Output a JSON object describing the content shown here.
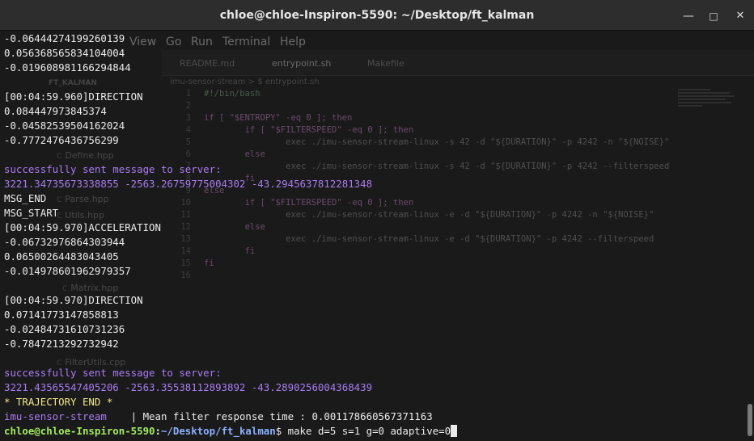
{
  "window": {
    "title": "chloe@chloe-Inspiron-5590: ~/Desktop/ft_kalman"
  },
  "ghost": {
    "menu": [
      "View",
      "Go",
      "Run",
      "Terminal",
      "Help"
    ],
    "tabs": [
      "README.md",
      "entrypoint.sh",
      "Makefile"
    ],
    "breadcrumb": "imu-sensor-stream  >  $  entrypoint.sh",
    "explorer_section": "FT_KALMAN",
    "files": [
      "Define.hpp",
      "Parse.hpp",
      "Utils.hpp",
      "Matrix.hpp",
      "FilterUtils.cpp"
    ],
    "code_lines": [
      {
        "n": "1",
        "t": "#!/bin/bash",
        "k": "cm"
      },
      {
        "n": "2",
        "t": "",
        "k": "plain"
      },
      {
        "n": "3",
        "t": "if [ \"$ENTROPY\" -eq 0 ]; then",
        "k": "kw"
      },
      {
        "n": "4",
        "t": "        if [ \"$FILTERSPEED\" -eq 0 ]; then",
        "k": "kw"
      },
      {
        "n": "5",
        "t": "                exec ./imu-sensor-stream-linux -s 42 -d \"${DURATION}\" -p 4242 -n \"${NOISE}\"",
        "k": "plain"
      },
      {
        "n": "6",
        "t": "        else",
        "k": "kw"
      },
      {
        "n": "7",
        "t": "                exec ./imu-sensor-stream-linux -s 42 -d \"${DURATION}\" -p 4242 --filterspeed",
        "k": "plain"
      },
      {
        "n": "8",
        "t": "        fi",
        "k": "kw"
      },
      {
        "n": "9",
        "t": "else",
        "k": "kw"
      },
      {
        "n": "10",
        "t": "        if [ \"$FILTERSPEED\" -eq 0 ]; then",
        "k": "kw"
      },
      {
        "n": "11",
        "t": "                exec ./imu-sensor-stream-linux -e -d \"${DURATION}\" -p 4242 -n \"${NOISE}\"",
        "k": "plain"
      },
      {
        "n": "12",
        "t": "        else",
        "k": "kw"
      },
      {
        "n": "13",
        "t": "                exec ./imu-sensor-stream-linux -e -d \"${DURATION}\" -p 4242 --filterspeed",
        "k": "plain"
      },
      {
        "n": "14",
        "t": "        fi",
        "k": "kw"
      },
      {
        "n": "15",
        "t": "fi",
        "k": "kw"
      },
      {
        "n": "16",
        "t": "",
        "k": "plain"
      }
    ]
  },
  "terminal": {
    "lines": [
      {
        "text": "-0.06444274199260139",
        "color": "white"
      },
      {
        "text": "0.05636856583410400​4",
        "color": "white"
      },
      {
        "text": "-0.019608981166294844",
        "color": "white"
      },
      {
        "text": "",
        "color": "white"
      },
      {
        "text": "[00:04:59.960]DIRECTION",
        "color": "white"
      },
      {
        "text": "0.084447973845374",
        "color": "white"
      },
      {
        "text": "-0.04582539504162024",
        "color": "white"
      },
      {
        "text": "-0.7772476436756299",
        "color": "white"
      },
      {
        "text": "",
        "color": "white"
      },
      {
        "text": "successfully sent message to server:",
        "color": "purple"
      },
      {
        "text": "3221.3473567333885​5 -2563.26759775004302 -43.2945637812281348",
        "color": "purple"
      },
      {
        "text": "MSG_END",
        "color": "white"
      },
      {
        "text": "MSG_START",
        "color": "white"
      },
      {
        "text": "[00:04:59.970]ACCELERATION",
        "color": "white"
      },
      {
        "text": "-0.06732976864303944",
        "color": "white"
      },
      {
        "text": "0.06500264483043405",
        "color": "white"
      },
      {
        "text": "-0.014978601962979357",
        "color": "white"
      },
      {
        "text": "",
        "color": "white"
      },
      {
        "text": "[00:04:59.970]DIRECTION",
        "color": "white"
      },
      {
        "text": "0.07141773147858813",
        "color": "white"
      },
      {
        "text": "-0.02484731610731236",
        "color": "white"
      },
      {
        "text": "-0.7847213292732942",
        "color": "white"
      },
      {
        "text": "",
        "color": "white"
      },
      {
        "text": "successfully sent message to server:",
        "color": "purple"
      },
      {
        "text": "3221.43565547405206 -2563.35538112893892 -43.2890256004368439",
        "color": "purple"
      },
      {
        "text": "* TRAJECTORY END *",
        "color": "yellow"
      }
    ],
    "status_line": {
      "name": "imu-sensor-stream",
      "separator": "    | ",
      "message": "Mean filter response time : 0.001178660567371163"
    },
    "prompt": {
      "user_host": "chloe@chloe-Inspiron-5590",
      "colon": ":",
      "path": "~/Desktop/ft_kalman",
      "dollar": "$ ",
      "command": "make d=5 s=1 g=0 adaptive=0"
    }
  },
  "colors": {
    "purple": "#a87cf2",
    "yellow": "#f1e88a",
    "green": "#a3ea5c",
    "blue": "#8ab0ff",
    "white": "#ececec",
    "background": "#1a1a1a"
  }
}
